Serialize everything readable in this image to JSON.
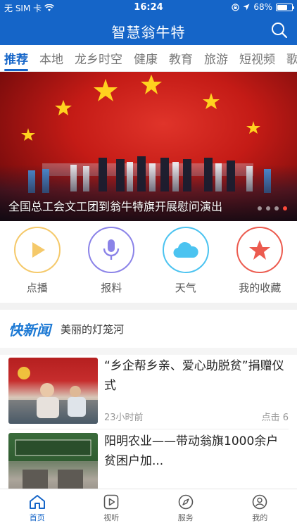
{
  "status_bar": {
    "carrier": "无 SIM 卡",
    "time": "16:24",
    "battery": "68%",
    "battery_level": 0.68
  },
  "header": {
    "title": "智慧翁牛特",
    "search_icon": "search-icon"
  },
  "tabs": [
    {
      "label": "推荐",
      "active": true
    },
    {
      "label": "本地"
    },
    {
      "label": "龙乡时空"
    },
    {
      "label": "健康"
    },
    {
      "label": "教育"
    },
    {
      "label": "旅游"
    },
    {
      "label": "短视频"
    },
    {
      "label": "歌"
    }
  ],
  "hero": {
    "caption": "全国总工会文工团到翁牛特旗开展慰问演出",
    "slide_count": 4,
    "active_slide": 4
  },
  "shortcuts": [
    {
      "label": "点播",
      "icon": "play-icon",
      "color": "#f5c96a"
    },
    {
      "label": "报料",
      "icon": "microphone-icon",
      "color": "#8b83e8"
    },
    {
      "label": "天气",
      "icon": "cloud-icon",
      "color": "#4bc3f0"
    },
    {
      "label": "我的收藏",
      "icon": "star-icon",
      "color": "#ec5b4f"
    }
  ],
  "quick_news": {
    "logo": "快新闻",
    "headline": "美丽的灯笼河"
  },
  "news": [
    {
      "title": "“乡企帮乡亲、爱心助脱贫”捐赠仪式",
      "time": "23小时前",
      "clicks": "点击 6"
    },
    {
      "title": "阳明农业——带动翁旗1000余户贫困户加..."
    }
  ],
  "bottom_nav": [
    {
      "label": "首页",
      "icon": "home-icon",
      "active": true
    },
    {
      "label": "视听",
      "icon": "play-square-icon"
    },
    {
      "label": "服务",
      "icon": "compass-icon"
    },
    {
      "label": "我的",
      "icon": "user-icon"
    }
  ],
  "colors": {
    "brand_blue": "#1565c8",
    "quick_news_blue": "#1c79d4",
    "active_dot": "#ff4a3a"
  }
}
